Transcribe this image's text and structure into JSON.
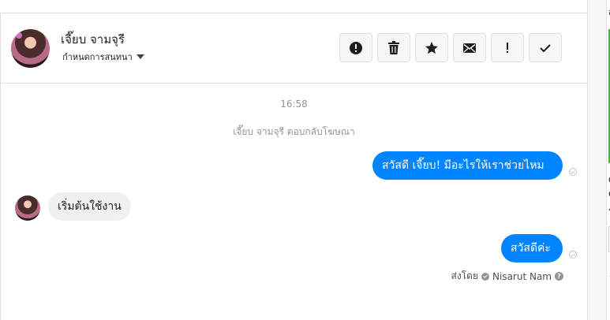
{
  "header": {
    "contact_name": "เจี๊ยบ จามจุรี",
    "conversation_settings_label": "กำหนดการสนทนา",
    "toolbar": [
      {
        "name": "report-spam-button",
        "icon": "exclamation-circle-icon"
      },
      {
        "name": "delete-button",
        "icon": "trash-icon"
      },
      {
        "name": "star-button",
        "icon": "star-icon"
      },
      {
        "name": "mark-unread-button",
        "icon": "envelope-icon"
      },
      {
        "name": "mark-important-button",
        "icon": "exclamation-icon"
      },
      {
        "name": "mark-done-button",
        "icon": "checkmark-icon"
      }
    ]
  },
  "thread": {
    "timestamp": "16:58",
    "system_note": "เจี๊ยบ จามจุรี ตอบกลับโฆษณา",
    "messages": [
      {
        "direction": "outgoing",
        "text": "สวัสดี เจี๊ยบ! มีอะไรให้เราช่วยไหม"
      },
      {
        "direction": "incoming",
        "text": "เริ่มต้นใช้งาน"
      },
      {
        "direction": "outgoing",
        "text": "สวัสดีค่ะ"
      }
    ],
    "sent_by_label": "ส่งโดย",
    "sent_by_name": "Nisarut Nam"
  },
  "right_panel": {
    "letters": [
      "ส",
      "C",
      "C",
      "ร"
    ]
  },
  "colors": {
    "outgoing_bubble": "#0084ff",
    "incoming_bubble": "#f1f0f0",
    "accent_green": "#42b72a"
  }
}
